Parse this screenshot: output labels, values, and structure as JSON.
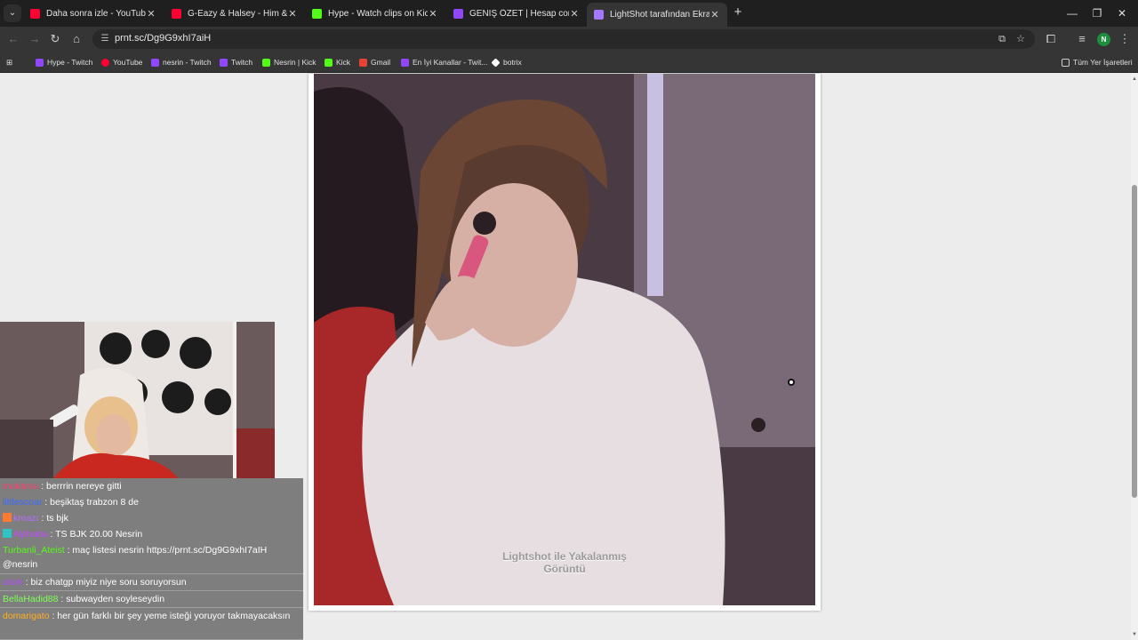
{
  "tabs": [
    {
      "title": "Daha sonra izle - YouTube",
      "icon": "youtube-icon",
      "color": "#ff0033",
      "active": false
    },
    {
      "title": "G-Eazy & Halsey - Him & I (Lyric",
      "icon": "youtube-icon",
      "color": "#ff0033",
      "active": false
    },
    {
      "title": "Hype - Watch clips on Kick",
      "icon": "kick-icon",
      "color": "#53fc18",
      "active": false
    },
    {
      "title": "GENİŞ ÖZET | Hesap com Antal",
      "icon": "twitch-icon",
      "color": "#9146ff",
      "active": false
    },
    {
      "title": "LightShot tarafından Ekran Gör",
      "icon": "lightshot-icon",
      "color": "#a478ff",
      "active": true
    }
  ],
  "new_tab": "+",
  "address": {
    "url": "prnt.sc/Dg9G9xhI7aiH"
  },
  "profile_initial": "N",
  "bookmarks": [
    {
      "label": "Hype - Twitch",
      "icon": "twitch-icon",
      "color": "#9146ff"
    },
    {
      "label": "YouTube",
      "icon": "youtube-icon",
      "color": "#ff0033"
    },
    {
      "label": "nesrin - Twitch",
      "icon": "twitch-icon",
      "color": "#9146ff"
    },
    {
      "label": "Twitch",
      "icon": "twitch-icon",
      "color": "#9146ff"
    },
    {
      "label": "Nesrin | Kick",
      "icon": "kick-icon",
      "color": "#53fc18"
    },
    {
      "label": "Kick",
      "icon": "kick-icon",
      "color": "#53fc18"
    },
    {
      "label": "Gmail",
      "icon": "gmail-icon",
      "color": "#ea4335"
    },
    {
      "label": "En İyi Kanallar - Twit...",
      "icon": "twitch-icon",
      "color": "#9146ff"
    },
    {
      "label": "botrix",
      "icon": "botrix-icon",
      "color": "#ffffff"
    }
  ],
  "all_bookmarks": "Tüm Yer İşaretleri",
  "caption": "Lightshot ile Yakalanmış Görüntü",
  "chat": [
    {
      "user": "mukarsu",
      "color": "#ff3b6b",
      "text": ": berrrin nereye gitti"
    },
    {
      "user": "littlescoar",
      "color": "#3b6bff",
      "text": ": beşiktaş trabzon 8 de"
    },
    {
      "user": "kreazı",
      "color": "#b66bff",
      "text": ": ts bjk"
    },
    {
      "user": "Alphaba",
      "color": "#c04bff",
      "text": ": TS BJK 20.00 Nesrin"
    },
    {
      "user": "Turbanli_Ateist",
      "color": "#53fc18",
      "text": ": maç listesi nesrin https://prnt.sc/Dg9G9xhI7aIH @nesrin"
    },
    {
      "user": "ulurk",
      "color": "#b04bff",
      "text": ": biz chatgp miyiz niye soru soruyorsun"
    },
    {
      "user": "BellaHadid88",
      "color": "#7dff5a",
      "text": ": subwayden soyleseydin"
    },
    {
      "user": "domarigato",
      "color": "#ffb020",
      "text": ": her gün farklı bir şey yeme isteği yoruyor takmayacaksın"
    }
  ]
}
